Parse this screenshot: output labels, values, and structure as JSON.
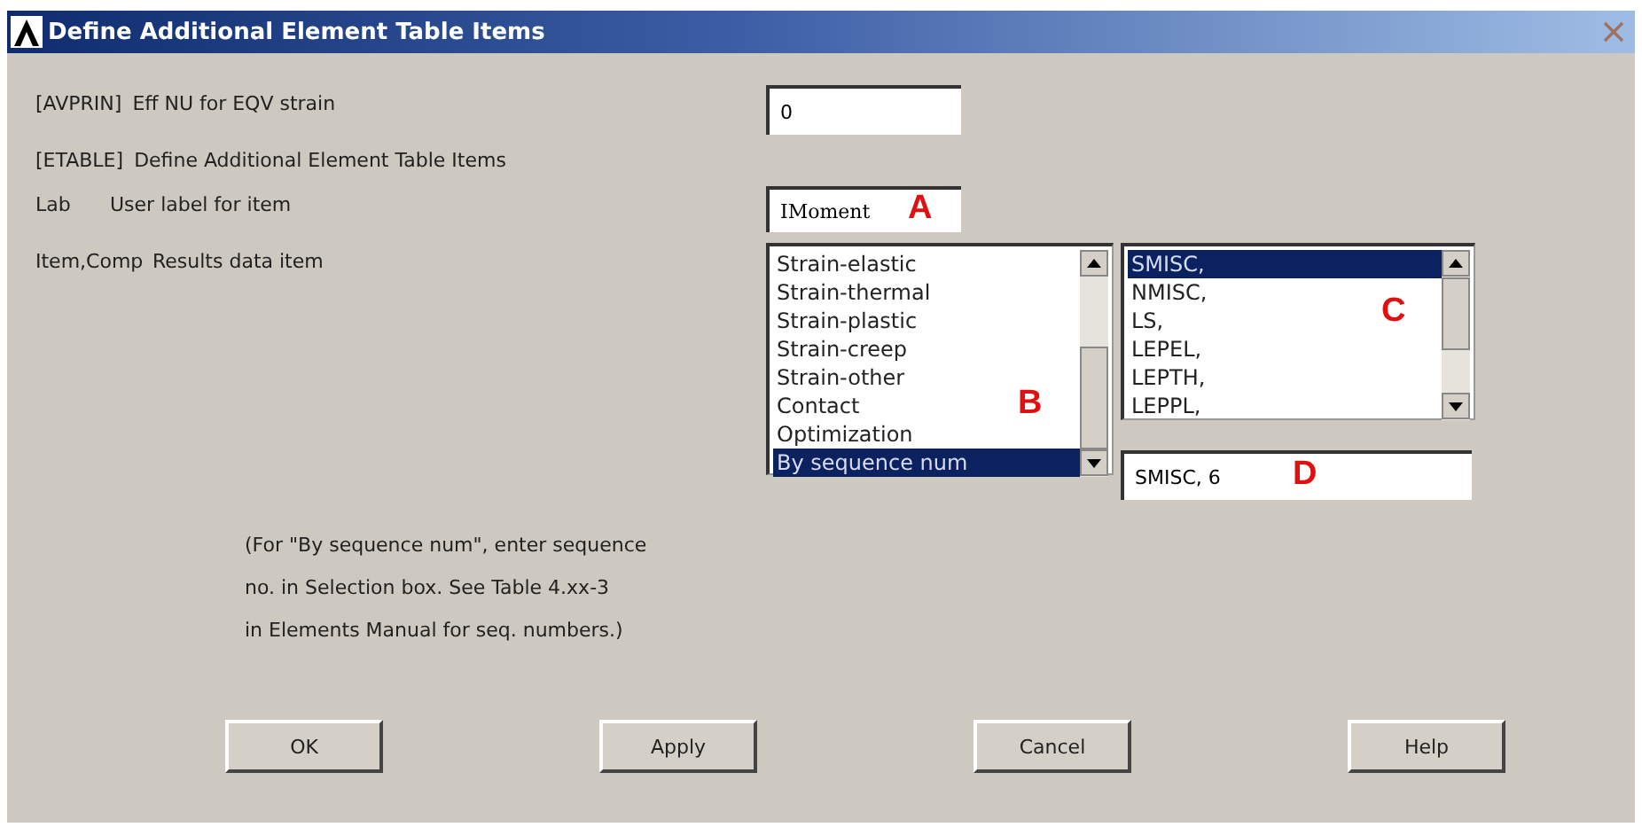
{
  "window": {
    "title": "Define Additional Element Table Items"
  },
  "avprin": {
    "key": "[AVPRIN]",
    "label": "Eff NU for EQV strain",
    "value": "0"
  },
  "etable": {
    "key": "[ETABLE]",
    "label": "Define Additional Element Table Items"
  },
  "lab": {
    "key": "Lab",
    "label": "User label for item",
    "value": "IMoment",
    "annotation": "A"
  },
  "item_comp": {
    "key": "Item,Comp",
    "label": "Results data item",
    "item_list": {
      "annotation": "B",
      "items": [
        {
          "label": "Strain-elastic",
          "selected": false
        },
        {
          "label": "Strain-thermal",
          "selected": false
        },
        {
          "label": "Strain-plastic",
          "selected": false
        },
        {
          "label": "Strain-creep",
          "selected": false
        },
        {
          "label": "Strain-other",
          "selected": false
        },
        {
          "label": "Contact",
          "selected": false
        },
        {
          "label": "Optimization",
          "selected": false
        },
        {
          "label": "By sequence num",
          "selected": true
        }
      ]
    },
    "comp_list": {
      "annotation": "C",
      "items": [
        {
          "label": "SMISC,",
          "selected": true
        },
        {
          "label": "NMISC,",
          "selected": false
        },
        {
          "label": "LS,",
          "selected": false
        },
        {
          "label": "LEPEL,",
          "selected": false
        },
        {
          "label": "LEPTH,",
          "selected": false
        },
        {
          "label": "LEPPL,",
          "selected": false
        }
      ]
    },
    "selection": {
      "value": "SMISC, 6",
      "annotation": "D"
    }
  },
  "note": [
    "(For \"By sequence num\", enter sequence",
    "no. in Selection box.  See Table 4.xx-3",
    "in Elements Manual for seq. numbers.)"
  ],
  "buttons": [
    "OK",
    "Apply",
    "Cancel",
    "Help"
  ]
}
